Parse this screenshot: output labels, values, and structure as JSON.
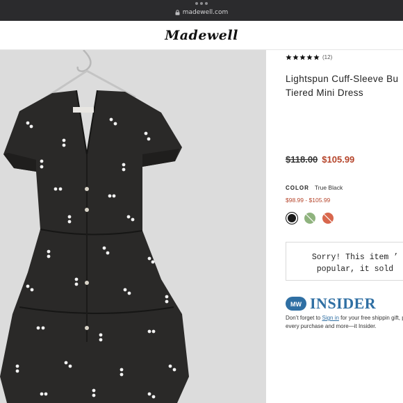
{
  "browser": {
    "url": "madewell.com"
  },
  "header": {
    "logo": "Madewell"
  },
  "product": {
    "image_alt": "black dress with white dots",
    "rating_stars": 5,
    "rating_count": "(12)",
    "title_line1": "Lightspun Cuff-Sleeve Bu",
    "title_line2": "Tiered Mini Dress",
    "price_original": "$118.00",
    "price_sale": "$105.99",
    "color_label": "COLOR",
    "color_value": "True Black",
    "price_range": "$98.99 - $105.99",
    "swatches": [
      {
        "name": "black",
        "color": "#1a1a1a",
        "selected": true
      },
      {
        "name": "green",
        "color": "#8fb37e",
        "selected": false
      },
      {
        "name": "coral",
        "color": "#d8674d",
        "selected": false
      }
    ],
    "soldout_message": "Sorry! This item ’\npopular, it sold"
  },
  "insider": {
    "badge": "MW",
    "heading": "INSIDER",
    "text_before_link": "Don’t forget to ",
    "link_text": "Sign in",
    "text_after_link": " for your free shippin gift, points on every purchase and more—it Insider."
  },
  "colors": {
    "browser_bar": "#2b2b2d",
    "sale_red": "#b5442a",
    "insider_blue": "#2f6fa3",
    "image_bg": "#dcdcdc"
  }
}
